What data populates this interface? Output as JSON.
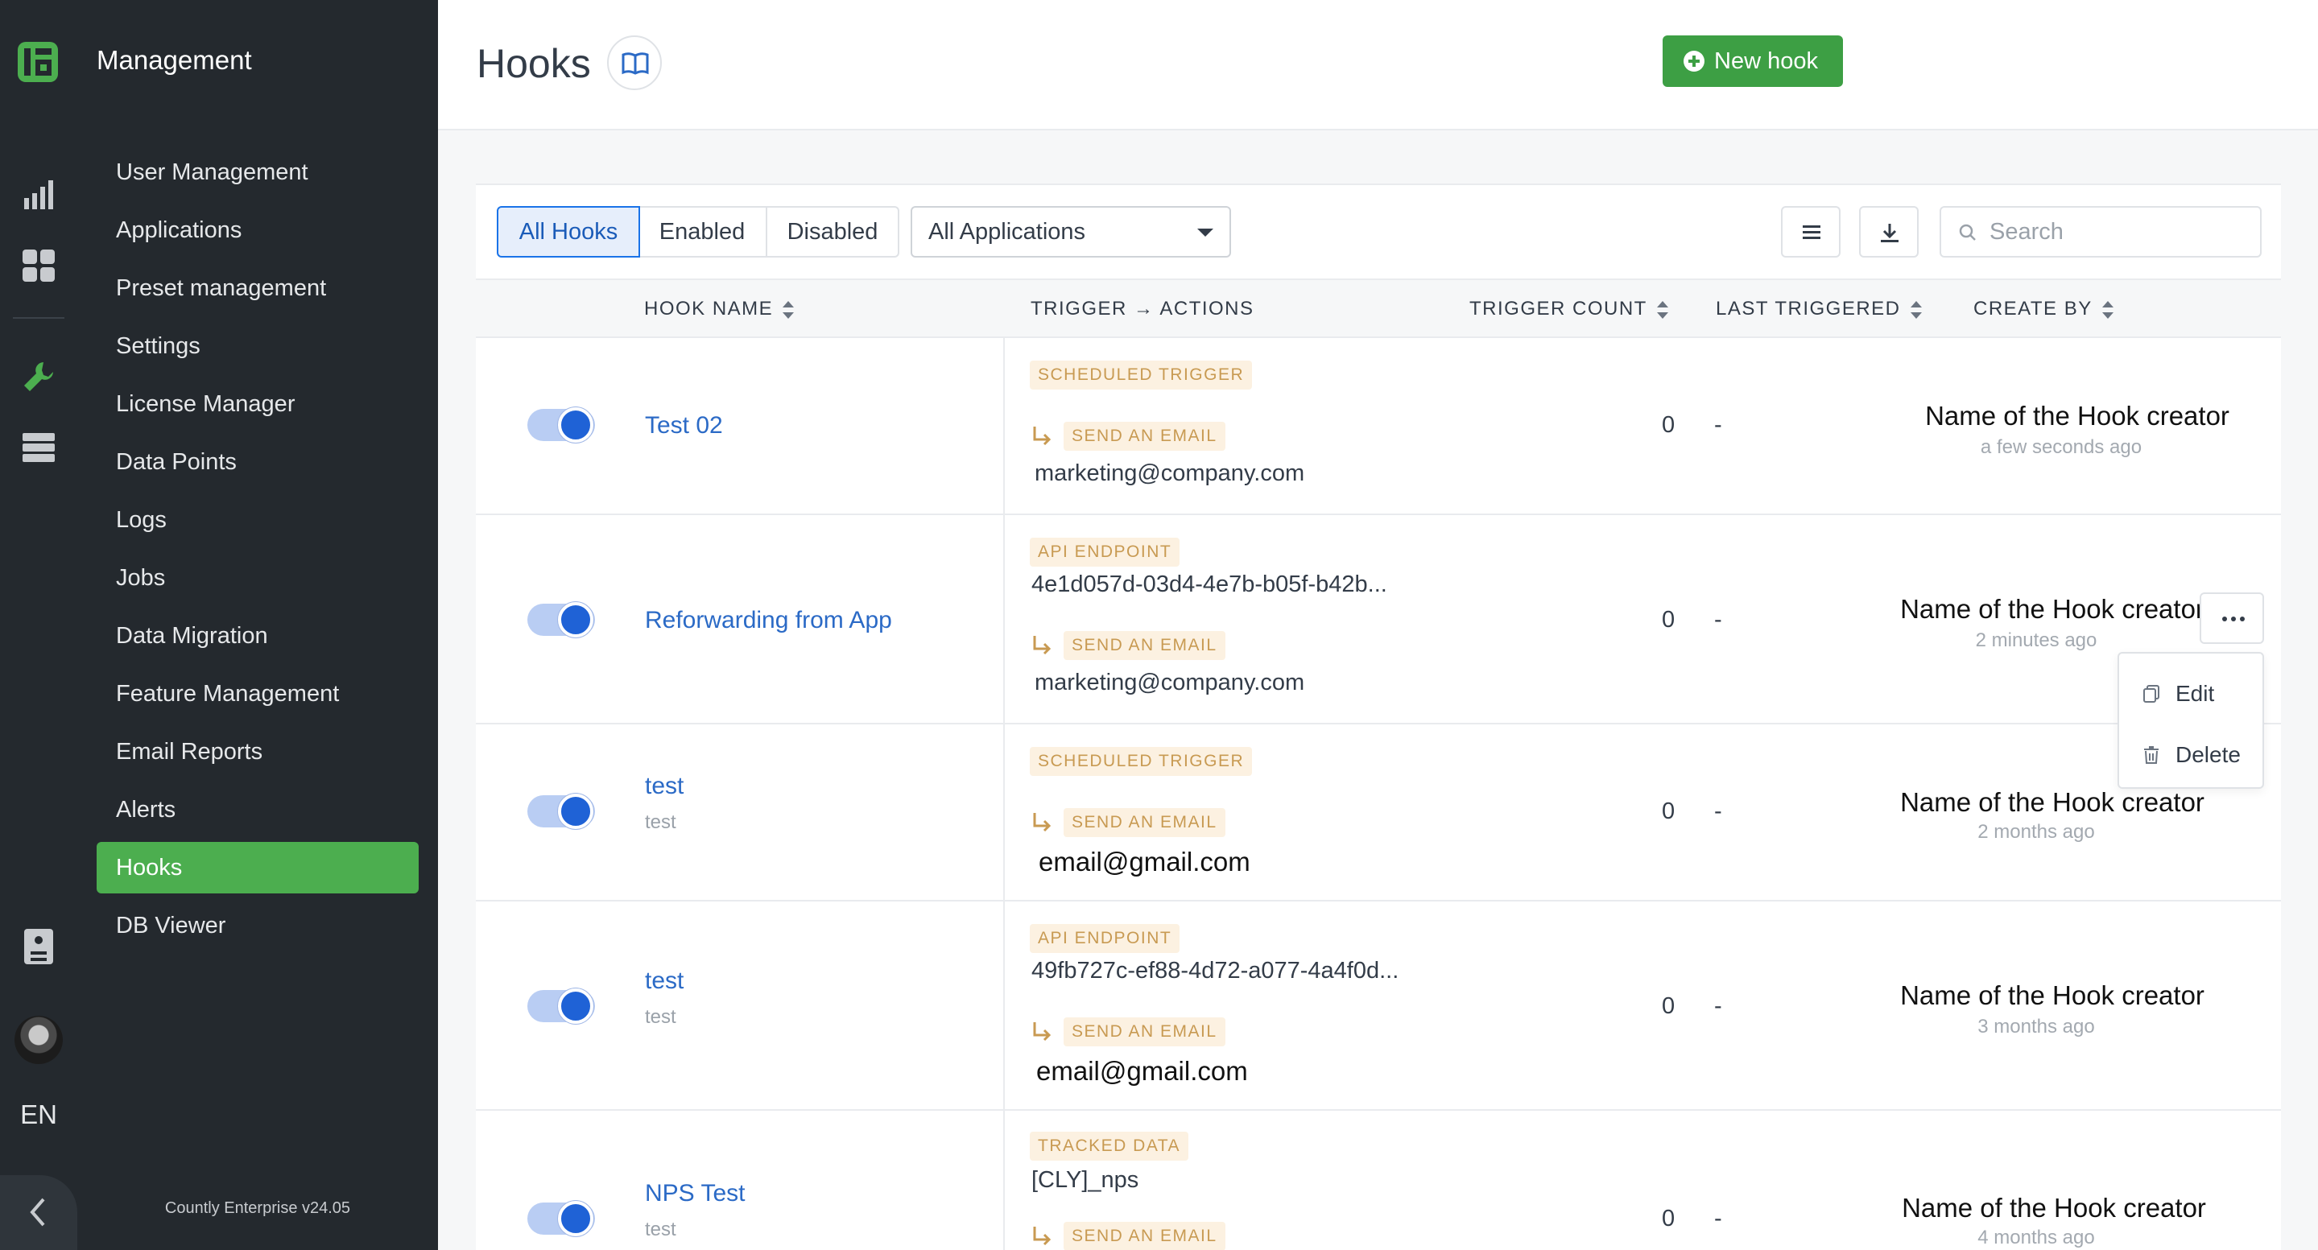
{
  "sidebar": {
    "title": "Management",
    "items": [
      {
        "label": "User Management"
      },
      {
        "label": "Applications"
      },
      {
        "label": "Preset management"
      },
      {
        "label": "Settings"
      },
      {
        "label": "License Manager"
      },
      {
        "label": "Data Points"
      },
      {
        "label": "Logs"
      },
      {
        "label": "Jobs"
      },
      {
        "label": "Data Migration"
      },
      {
        "label": "Feature Management"
      },
      {
        "label": "Email Reports"
      },
      {
        "label": "Alerts"
      },
      {
        "label": "Hooks",
        "active": true
      },
      {
        "label": "DB Viewer"
      }
    ],
    "version": "Countly Enterprise v24.05",
    "language": "EN"
  },
  "header": {
    "title": "Hooks",
    "new_button": "New hook"
  },
  "filters": {
    "tabs": [
      "All Hooks",
      "Enabled",
      "Disabled"
    ],
    "active_tab": "All Hooks",
    "app_select": "All Applications",
    "search_placeholder": "Search"
  },
  "table": {
    "columns": [
      "HOOK NAME",
      "TRIGGER → ACTIONS",
      "TRIGGER COUNT",
      "LAST TRIGGERED",
      "CREATE BY"
    ],
    "rows": [
      {
        "name": "Test 02",
        "description": "",
        "enabled": true,
        "trigger_type": "SCHEDULED TRIGGER",
        "trigger_value": "",
        "action_type": "SEND AN EMAIL",
        "action_value": "marketing@company.com",
        "count": "0",
        "last": "-",
        "creator": "Name of the Hook creator",
        "created": "a few seconds ago"
      },
      {
        "name": "Reforwarding from App",
        "description": "",
        "enabled": true,
        "trigger_type": "API ENDPOINT",
        "trigger_value": "4e1d057d-03d4-4e7b-b05f-b42b...",
        "action_type": "SEND AN EMAIL",
        "action_value": "marketing@company.com",
        "count": "0",
        "last": "-",
        "creator": "Name of the Hook creator",
        "created": "2 minutes ago"
      },
      {
        "name": "test",
        "description": "test",
        "enabled": true,
        "trigger_type": "SCHEDULED TRIGGER",
        "trigger_value": "",
        "action_type": "SEND AN EMAIL",
        "action_value": "email@gmail.com",
        "count": "0",
        "last": "-",
        "creator": "Name of the Hook creator",
        "created": "2 months ago"
      },
      {
        "name": "test",
        "description": "test",
        "enabled": true,
        "trigger_type": "API ENDPOINT",
        "trigger_value": "49fb727c-ef88-4d72-a077-4a4f0d...",
        "action_type": "SEND AN EMAIL",
        "action_value": "email@gmail.com",
        "count": "0",
        "last": "-",
        "creator": "Name of the Hook creator",
        "created": "3 months ago"
      },
      {
        "name": "NPS Test",
        "description": "test",
        "enabled": true,
        "trigger_type": "TRACKED DATA",
        "trigger_value": "[CLY]_nps",
        "action_type": "SEND AN EMAIL",
        "action_value": "",
        "count": "0",
        "last": "-",
        "creator": "Name of the Hook creator",
        "created": "4 months ago"
      }
    ]
  },
  "row_menu": {
    "items": [
      "Edit",
      "Delete"
    ]
  },
  "colors": {
    "accent": "#4cae4f",
    "link": "#2b6ac6",
    "toggle": "#1f62d6",
    "badge_bg": "#fcf1e1",
    "badge_text": "#c89a52",
    "sidebar_bg": "#24292e"
  },
  "icons": {
    "logo": "countly-logo-icon",
    "rail": [
      "analytics-bar-icon",
      "dashboard-grid-icon",
      "wrench-icon",
      "server-icon",
      "document-icon"
    ],
    "header_doc": "book-icon",
    "table_tools": [
      "list-icon",
      "download-icon"
    ],
    "search": "search-icon",
    "menu": [
      "copy-icon",
      "trash-icon"
    ]
  }
}
